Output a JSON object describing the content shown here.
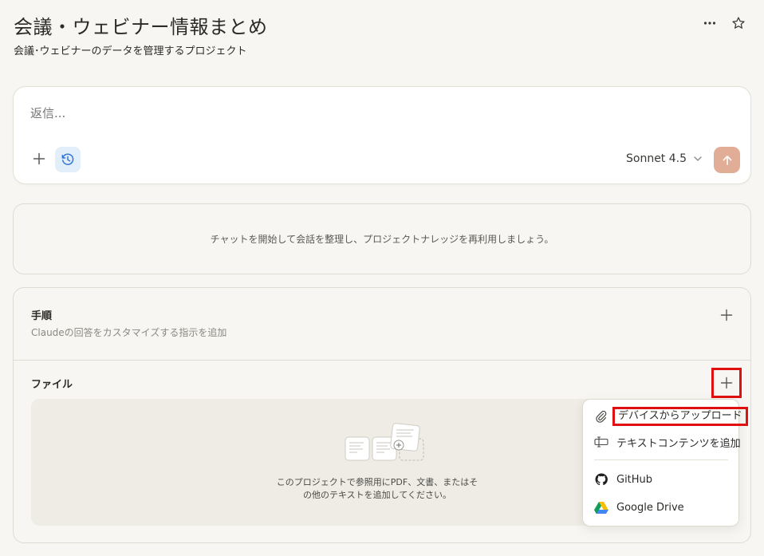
{
  "header": {
    "title": "会議・ウェビナー情報まとめ",
    "subtitle": "会議･ウェビナーのデータを管理するプロジェクト",
    "more_icon": "more-horizontal-icon",
    "star_icon": "star-icon"
  },
  "composer": {
    "placeholder": "返信...",
    "model": "Sonnet 4.5",
    "send_color": "#e2ad96"
  },
  "chat_empty": {
    "text": "チャットを開始して会話を整理し、プロジェクトナレッジを再利用しましょう。"
  },
  "instructions": {
    "title": "手順",
    "description": "Claudeの回答をカスタマイズする指示を追加"
  },
  "files": {
    "title": "ファイル",
    "empty_line1": "このプロジェクトで参照用にPDF、文書、またはそ",
    "empty_line2": "の他のテキストを追加してください。"
  },
  "add_menu": {
    "items": [
      {
        "label": "デバイスからアップロード",
        "icon": "paperclip-icon"
      },
      {
        "label": "テキストコンテンツを追加",
        "icon": "text-cursor-icon"
      },
      {
        "label": "GitHub",
        "icon": "github-icon"
      },
      {
        "label": "Google Drive",
        "icon": "google-drive-icon"
      }
    ]
  },
  "colors": {
    "background": "#f8f6f2",
    "highlight": "#e01010",
    "accent_blue": "#e3eefb"
  }
}
